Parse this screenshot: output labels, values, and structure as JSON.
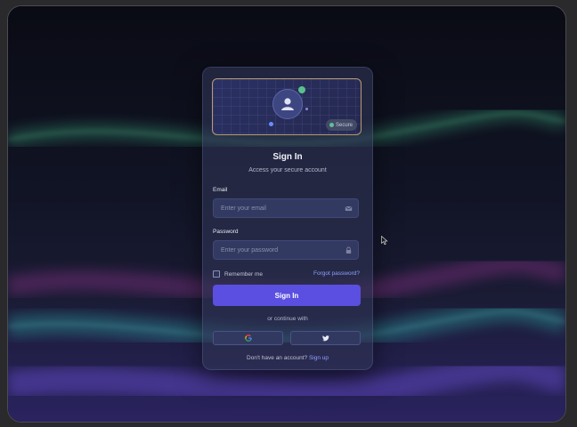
{
  "card": {
    "title": "Sign In",
    "subtitle": "Access your secure account",
    "badge_label": "Secure",
    "email": {
      "label": "Email",
      "placeholder": "Enter your email",
      "icon": "mail-icon"
    },
    "password": {
      "label": "Password",
      "placeholder": "Enter your password",
      "icon": "lock-icon"
    },
    "remember_label": "Remember me",
    "remember_checked": false,
    "forgot_label": "Forgot password?",
    "submit_label": "Sign In",
    "divider_text": "or continue with",
    "social": [
      {
        "name": "google",
        "icon": "google-icon"
      },
      {
        "name": "twitter",
        "icon": "twitter-icon"
      }
    ],
    "footer_text": "Don't have an account?",
    "footer_link": "Sign up"
  },
  "colors": {
    "accent": "#5a4fe0",
    "link": "#8ea0ff",
    "badge_dot": "#5fbf9a",
    "background": "#0b0c16"
  }
}
